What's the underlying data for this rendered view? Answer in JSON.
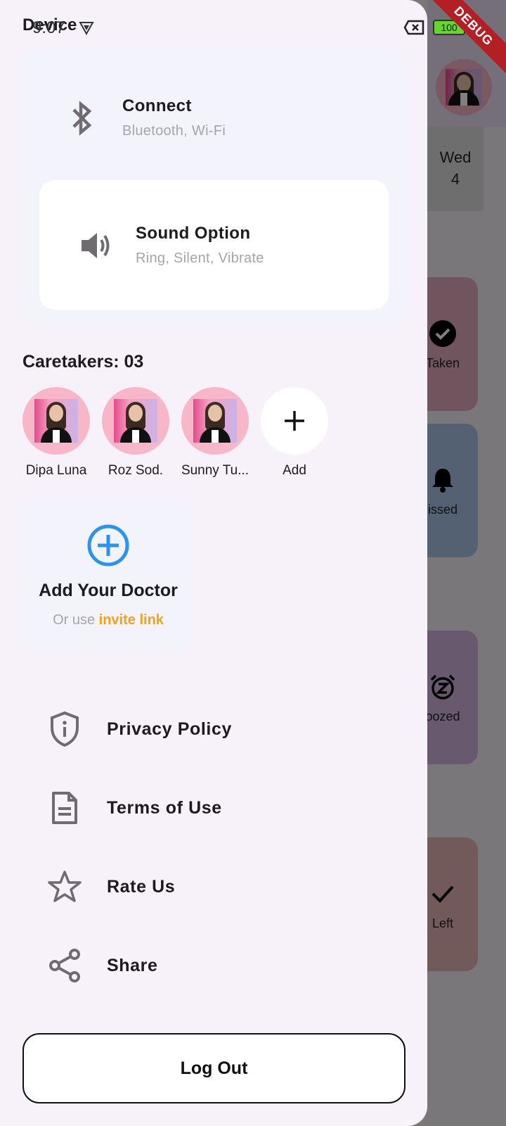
{
  "status_bar": {
    "time": "9:07",
    "battery": "100"
  },
  "debug_banner": "DEBUG",
  "background": {
    "date": {
      "day": "Wed",
      "num": "4"
    },
    "cards": [
      {
        "label": "Taken",
        "color": "#8c6f7e"
      },
      {
        "label": "issed",
        "color": "#5d6c80"
      },
      {
        "label": "oozed",
        "color": "#76657e"
      },
      {
        "label": "Left",
        "color": "#8a7273"
      }
    ]
  },
  "drawer": {
    "title": "Device",
    "connect": {
      "title": "Connect",
      "subtitle": "Bluetooth, Wi-Fi",
      "icon": "bluetooth-icon"
    },
    "sound": {
      "title": "Sound Option",
      "subtitle": "Ring, Silent, Vibrate",
      "icon": "volume-icon"
    },
    "caretakers": {
      "title": "Caretakers: 03",
      "items": [
        {
          "name": "Dipa Luna"
        },
        {
          "name": "Roz Sod."
        },
        {
          "name": "Sunny Tu..."
        }
      ],
      "add_label": "Add"
    },
    "doctor": {
      "title": "Add Your Doctor",
      "sub_prefix": "Or use ",
      "link": "invite link",
      "accent": "#f0a21a",
      "plus_color": "#2b94e8"
    },
    "menu": [
      {
        "label": "Privacy Policy",
        "icon": "shield-info-icon"
      },
      {
        "label": "Terms of Use",
        "icon": "document-icon"
      },
      {
        "label": "Rate Us",
        "icon": "star-icon"
      },
      {
        "label": "Share",
        "icon": "share-icon"
      }
    ],
    "logout": "Log Out"
  }
}
